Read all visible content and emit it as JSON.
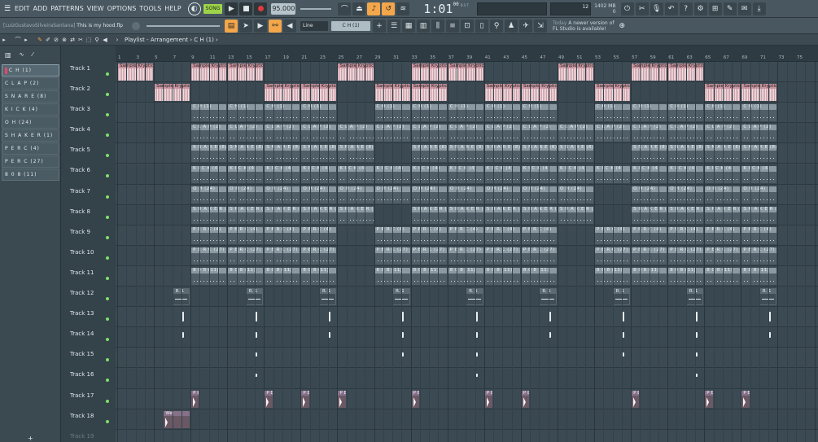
{
  "menu": {
    "items": [
      "EDIT",
      "ADD",
      "PATTERNS",
      "VIEW",
      "OPTIONS",
      "TOOLS",
      "HELP"
    ]
  },
  "transport": {
    "mode": "SONG",
    "tempo": "95.000",
    "time": "1:01",
    "time_small": "00",
    "time_label": "B:S:T"
  },
  "resources": {
    "cpu": "12",
    "memory": "1402 MB",
    "voices": "0"
  },
  "project": {
    "author": "[LuizGustavoSilveiraSantana]",
    "name": "This is my hood.flp"
  },
  "snap": "Line",
  "pattern_selector": "C H (1)",
  "news": {
    "title": "Today",
    "line1": "A newer version of",
    "line2": "FL Studio is available!"
  },
  "playlist": {
    "breadcrumb": "Playlist - Arrangement › C H (1) ›"
  },
  "rack": {
    "items": [
      "C H (1)",
      "C L A P (2)",
      "S N A R E (8)",
      "K I C K (4)",
      "O H (24)",
      "S H A K E R (1)",
      "P E R C (4)",
      "P E R C (27)",
      "8 0 8 (11)"
    ],
    "add_label": "+"
  },
  "tracks": [
    "Track 1",
    "Track 2",
    "Track 3",
    "Track 4",
    "Track 5",
    "Track 6",
    "Track 7",
    "Track 8",
    "Track 9",
    "Track 10",
    "Track 11",
    "Track 12",
    "Track 13",
    "Track 14",
    "Track 15",
    "Track 16",
    "Track 17",
    "Track 18",
    "Track 19"
  ],
  "ruler_marks": [
    "1",
    "3",
    "5",
    "7",
    "9",
    "11",
    "13",
    "15",
    "17",
    "19",
    "21",
    "23",
    "25",
    "27",
    "29",
    "31",
    "33",
    "35",
    "37",
    "39",
    "41",
    "43",
    "45",
    "47",
    "49",
    "51",
    "53",
    "55",
    "57",
    "59",
    "61",
    "63",
    "65",
    "67",
    "69",
    "71",
    "73",
    "75"
  ],
  "clip_labels": {
    "sample": "Sample Kryptic",
    "ch": "C H (1)",
    "clap": "C L A P (2)",
    "snare": "S N A R E (8)",
    "kick": "K I C K (4)",
    "oh": "O H (24)",
    "shaker": "S H A K E R (1)",
    "perc4": "P E R C (4)",
    "perc27": "P E R C (27)",
    "bass": "8 0 8 (11)",
    "auto": "R. 1",
    "wet": "Wet"
  },
  "colors": {
    "accent": "#f4a64a",
    "record": "#e23b3b",
    "audio_clip": "#d9aeb6",
    "pattern_clip": "#8b9aa2",
    "active_led": "#7ee06b"
  }
}
